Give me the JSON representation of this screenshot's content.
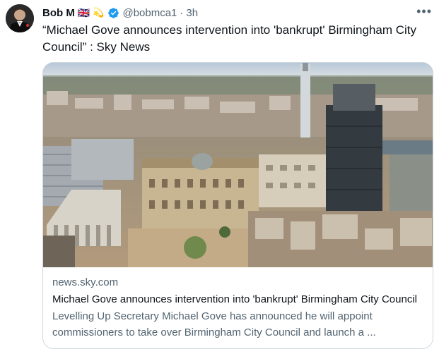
{
  "author": {
    "name": "Bob M",
    "handle": "@bobmca1",
    "separator": "·",
    "time": "3h",
    "flag_emoji": "🇬🇧",
    "badge_emoji": "💫",
    "verified": true
  },
  "tweet": {
    "text": "“Michael Gove announces intervention into 'bankrupt' Birmingham City Council” : Sky News"
  },
  "card": {
    "domain": "news.sky.com",
    "title": "Michael Gove announces intervention into 'bankrupt' Birmingham City Council",
    "description": "Levelling Up Secretary Michael Gove has announced he will appoint commissioners to take over Birmingham City Council and launch a ..."
  },
  "icons": {
    "more": "more-options-icon",
    "verified": "verified-badge-icon"
  },
  "colors": {
    "text_primary": "#0f1419",
    "text_secondary": "#536471",
    "border": "#cfd9de",
    "verified_blue": "#1d9bf0"
  }
}
